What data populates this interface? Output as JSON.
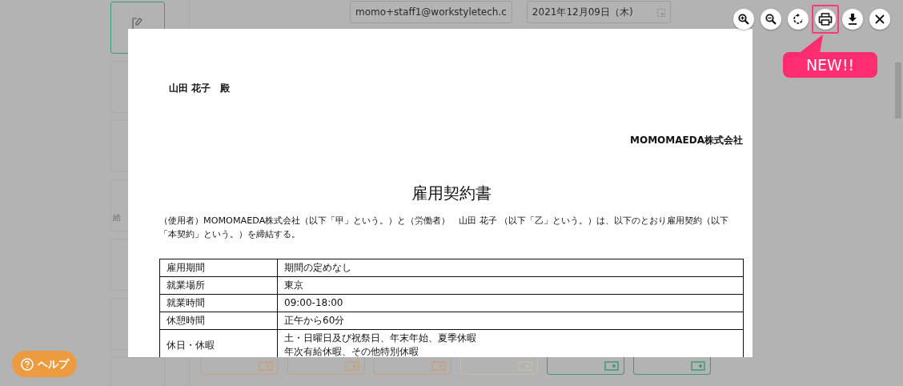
{
  "background": {
    "email_field": "momo+staff1@workstyletech.c",
    "date_field": "2021年12月09日（木)",
    "sidebar_fragment": "給",
    "help_button": "ヘルプ"
  },
  "viewer": {
    "toolbar": [
      {
        "kind": "zoom-in",
        "highlighted": false
      },
      {
        "kind": "zoom-out",
        "highlighted": false
      },
      {
        "kind": "rotate",
        "highlighted": false
      },
      {
        "kind": "print",
        "highlighted": true
      },
      {
        "kind": "download",
        "highlighted": false
      },
      {
        "kind": "close",
        "highlighted": false
      }
    ],
    "badge": "NEW!!"
  },
  "document": {
    "addressee": "山田 花子　殿",
    "company": "MOMOMAEDA株式会社",
    "title": "雇用契約書",
    "intro": "（使用者）MOMOMAEDA株式会社（以下「甲」という。）と（労働者）　山田 花子 （以下「乙」という。）は、以下のとおり雇用契約（以下「本契約」という。）を締結する。",
    "rows": [
      {
        "label": "雇用期間",
        "lines": [
          "期間の定めなし"
        ]
      },
      {
        "label": "就業場所",
        "lines": [
          "東京"
        ]
      },
      {
        "label": "就業時間",
        "lines": [
          "09:00-18:00"
        ]
      },
      {
        "label": "休憩時間",
        "lines": [
          "正午から60分"
        ]
      },
      {
        "label": "休日・休暇",
        "lines": [
          "土・日曜日及び祝祭日、年末年始、夏季休暇",
          "年次有給休暇、その他特別休暇"
        ]
      }
    ]
  }
}
